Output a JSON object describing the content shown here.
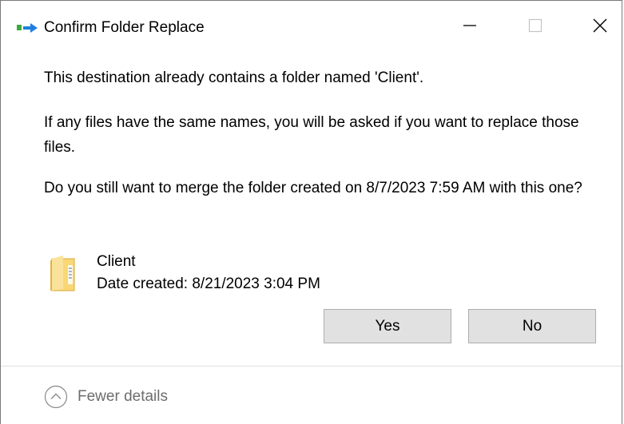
{
  "window": {
    "title": "Confirm Folder Replace"
  },
  "message": {
    "line1": "This destination already contains a folder named 'Client'.",
    "line2": "If any files have the same names, you will be asked if you want to replace those files.",
    "line3": "Do you still want to merge the folder created on 8/7/2023 7:59 AM with this one?"
  },
  "folder": {
    "name": "Client",
    "date_created": "Date created: 8/21/2023 3:04 PM"
  },
  "buttons": {
    "yes": "Yes",
    "no": "No"
  },
  "details_toggle": {
    "label": "Fewer details"
  },
  "icons": {
    "app": "folder-move-icon",
    "folder": "folder-icon",
    "minimize": "minimize-icon",
    "maximize": "maximize-icon",
    "close": "close-icon",
    "toggle": "chevron-up-circle-icon"
  },
  "colors": {
    "button_bg": "#e1e1e1",
    "button_border": "#adadad",
    "details_text": "#6d6d6d",
    "folder_yellow": "#f8d775"
  }
}
